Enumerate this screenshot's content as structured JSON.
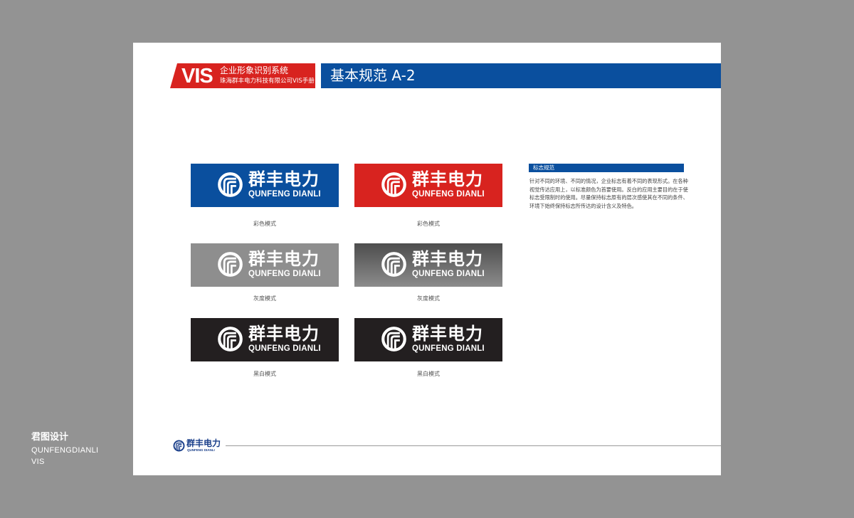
{
  "header": {
    "vis_label": "VIS",
    "vis_line1": "企业形象识别系统",
    "vis_line2": "珠海群丰电力科技有限公司VIS手册",
    "page_title": "基本规范 A-2"
  },
  "logo": {
    "cn": "群丰电力",
    "en": "QUNFENG DIANLI",
    "icon": "qunfeng-logo-mark"
  },
  "cards": [
    {
      "caption": "彩色模式",
      "bg": "#0a4f9e"
    },
    {
      "caption": "彩色模式",
      "bg": "#d8231f"
    },
    {
      "caption": "灰度模式",
      "bg": "#8e8e8e"
    },
    {
      "caption": "灰度模式",
      "bg": "#6e6e6e"
    },
    {
      "caption": "黑白模式",
      "bg": "#231f20"
    },
    {
      "caption": "黑白模式",
      "bg": "#231f20"
    }
  ],
  "spec": {
    "tag": "标志规范",
    "text": "针对不同的环境、不同的情况，企业标志有着不同的表现形式。在各种视觉传达应用上，以标准颜色为首要使用。反白的应用主要目的在于使标志受限制时的使用。尽量保持标志原有的层次感使其在不同的条件、环境下始终保持标志所传达的设计含义及特色。"
  },
  "footer": {
    "cn": "群丰电力",
    "en": "QUNFENG DIANLI"
  },
  "studio": {
    "line1": "君图设计",
    "line2": "QUNFENGDIANLI",
    "line3": "VIS"
  },
  "colors": {
    "brand_blue": "#0a4f9e",
    "brand_red": "#d8231f",
    "backdrop": "#939393"
  }
}
